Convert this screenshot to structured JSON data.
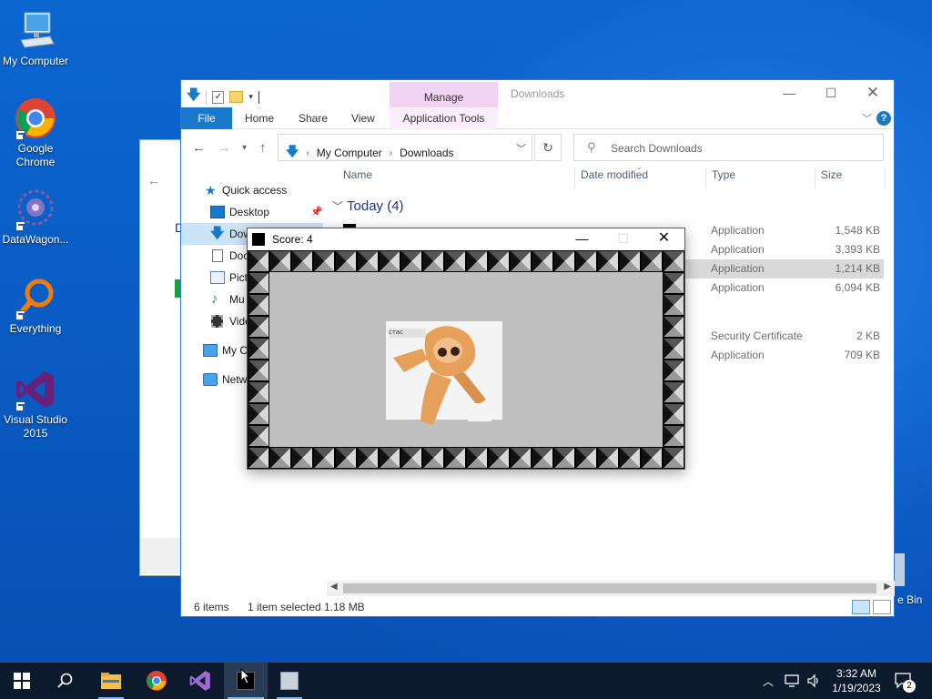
{
  "desktop": {
    "icons": [
      {
        "label": "My Computer"
      },
      {
        "label": "Google Chrome"
      },
      {
        "label": "DataWagon..."
      },
      {
        "label": "Everything"
      },
      {
        "label": "Visual Studio 2015"
      }
    ],
    "recycle_label": "e Bin"
  },
  "explorer": {
    "title": "Downloads",
    "manage_label": "Manage",
    "ribbon": {
      "file": "File",
      "home": "Home",
      "share": "Share",
      "view": "View",
      "app_tools": "Application Tools"
    },
    "address": {
      "crumb1": "My Computer",
      "crumb2": "Downloads"
    },
    "search_placeholder": "Search Downloads",
    "sidebar": {
      "quick_access": "Quick access",
      "desktop": "Desktop",
      "downloads": "Dow",
      "documents": "Doc",
      "pictures": "Pict",
      "music": "Mu",
      "videos": "Vide",
      "my_computer": "My C",
      "network": "Netw"
    },
    "columns": {
      "name": "Name",
      "date": "Date modified",
      "type": "Type",
      "size": "Size"
    },
    "group": "Today (4)",
    "rows": [
      {
        "type": "Application",
        "size": "1,548 KB"
      },
      {
        "type": "Application",
        "size": "3,393 KB"
      },
      {
        "type": "Application",
        "size": "1,214 KB"
      },
      {
        "type": "Application",
        "size": "6,094 KB"
      },
      {
        "type": "Security Certificate",
        "size": "2 KB"
      },
      {
        "type": "Application",
        "size": "709 KB"
      }
    ],
    "status": {
      "items": "6 items",
      "selected": "1 item selected",
      "size": "1.18 MB"
    }
  },
  "game": {
    "title": "Score: 4",
    "sprite_caption": "стас"
  },
  "taskbar": {
    "time": "3:32 AM",
    "date": "1/19/2023",
    "notifications": "2"
  },
  "colors": {
    "accent": "#1979ca",
    "manage_tab": "#f1d3f3",
    "selection": "#cce4f7",
    "arena": "#c0c0c0"
  }
}
